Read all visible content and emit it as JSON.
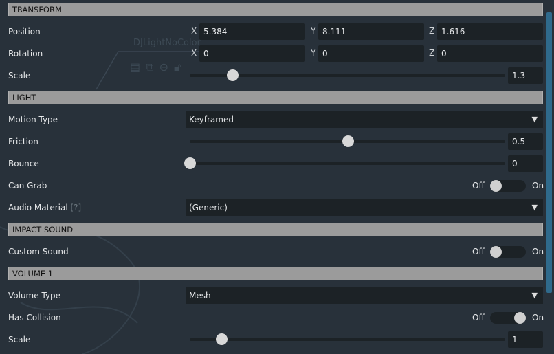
{
  "watermark": "DJLightNoColor",
  "sections": {
    "transform": "TRANSFORM",
    "light": "LIGHT",
    "impact": "IMPACT SOUND",
    "volume": "VOLUME 1"
  },
  "transform": {
    "position": {
      "label": "Position",
      "x": "5.384",
      "y": "8.111",
      "z": "1.616"
    },
    "rotation": {
      "label": "Rotation",
      "x": "0",
      "y": "0",
      "z": "0"
    },
    "scale": {
      "label": "Scale",
      "value": "1.3",
      "fraction": 0.135
    },
    "axes": {
      "x": "X",
      "y": "Y",
      "z": "Z"
    }
  },
  "light": {
    "motion_type": {
      "label": "Motion Type",
      "value": "Keyframed"
    },
    "friction": {
      "label": "Friction",
      "value": "0.5",
      "fraction": 0.5
    },
    "bounce": {
      "label": "Bounce",
      "value": "0",
      "fraction": 0
    },
    "can_grab": {
      "label": "Can Grab",
      "off": "Off",
      "on": "On",
      "state": false
    },
    "audio_material": {
      "label": "Audio Material",
      "help": "[?]",
      "value": "(Generic)"
    }
  },
  "impact": {
    "custom_sound": {
      "label": "Custom Sound",
      "off": "Off",
      "on": "On",
      "state": false
    }
  },
  "volume": {
    "volume_type": {
      "label": "Volume Type",
      "value": "Mesh"
    },
    "has_collision": {
      "label": "Has Collision",
      "off": "Off",
      "on": "On",
      "state": true
    },
    "scale": {
      "label": "Scale",
      "value": "1",
      "fraction": 0.1
    }
  },
  "icons": {
    "dropdown": "triangle-down"
  }
}
